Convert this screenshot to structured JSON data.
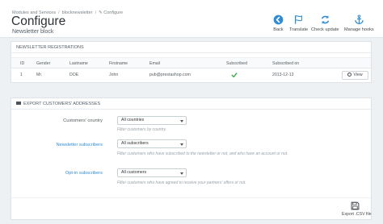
{
  "breadcrumb": [
    "Modules and Services",
    "blocknewsletter",
    "Configure"
  ],
  "page": {
    "title": "Configure",
    "subtitle": "Newsletter block"
  },
  "toolbar": [
    {
      "label": "Back",
      "icon": "back-arrow-icon"
    },
    {
      "label": "Translate",
      "icon": "flag-icon"
    },
    {
      "label": "Check update",
      "icon": "refresh-icon"
    },
    {
      "label": "Manage hooks",
      "icon": "anchor-icon"
    }
  ],
  "registrations": {
    "heading": "NEWSLETTER REGISTRATIONS",
    "columns": [
      "ID",
      "Gender",
      "Lastname",
      "Firstname",
      "Email",
      "Subscribed",
      "Subscribed on"
    ],
    "rows": [
      {
        "id": "1",
        "gender": "Mr.",
        "lastname": "DOE",
        "firstname": "John",
        "email": "pub@prestashop.com",
        "subscribed": "check-icon",
        "subscribed_on": "2013-12-13",
        "action": "View"
      }
    ]
  },
  "export": {
    "heading": "EXPORT CUSTOMERS' ADDRESSES",
    "fields": [
      {
        "label": "Customers' country",
        "value": "All countries",
        "help": "Filter customers by country."
      },
      {
        "label": "Newsletter subscribers",
        "value": "All subscribers",
        "help": "Filter customers who have subscribed to the newsletter or not, and who have an account or not."
      },
      {
        "label": "Opt-in subscribers",
        "value": "All customers",
        "help": "Filter customers who have agreed to receive your partners' offers or not."
      }
    ],
    "button": "Export .CSV file"
  },
  "colors": {
    "accent": "#2e8bd4",
    "success": "#3fae49",
    "text": "#555c60"
  }
}
